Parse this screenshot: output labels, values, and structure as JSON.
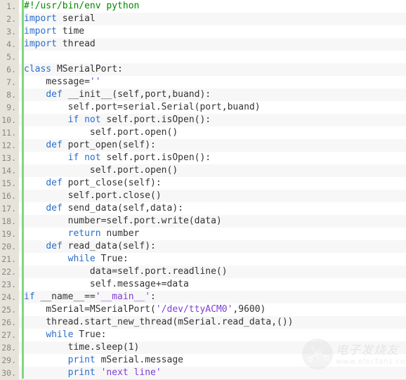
{
  "editor": {
    "language": "python",
    "gutter_suffix": ".",
    "colors": {
      "background": "#ffffff",
      "alt_row": "#f7f7f7",
      "gutter_background": "#e6e4da",
      "gutter_rule": "#7fd87f",
      "line_number": "#888680",
      "text": "#333333",
      "comment": "#008800",
      "keyword": "#2a6ecb",
      "string": "#7d3fd4"
    },
    "lines": [
      {
        "number": "1.",
        "tokens": [
          {
            "t": "#!/usr/bin/env python",
            "c": "comment"
          }
        ]
      },
      {
        "number": "2.",
        "tokens": [
          {
            "t": "import",
            "c": "keyword"
          },
          {
            "t": " serial",
            "c": "plain"
          }
        ]
      },
      {
        "number": "3.",
        "tokens": [
          {
            "t": "import",
            "c": "keyword"
          },
          {
            "t": " time",
            "c": "plain"
          }
        ]
      },
      {
        "number": "4.",
        "tokens": [
          {
            "t": "import",
            "c": "keyword"
          },
          {
            "t": " thread",
            "c": "plain"
          }
        ]
      },
      {
        "number": "5.",
        "tokens": []
      },
      {
        "number": "6.",
        "tokens": [
          {
            "t": "class",
            "c": "keyword"
          },
          {
            "t": " MSerialPort:",
            "c": "plain"
          }
        ]
      },
      {
        "number": "7.",
        "tokens": [
          {
            "t": "    message=",
            "c": "plain"
          },
          {
            "t": "''",
            "c": "string"
          }
        ]
      },
      {
        "number": "8.",
        "tokens": [
          {
            "t": "    ",
            "c": "plain"
          },
          {
            "t": "def",
            "c": "keyword"
          },
          {
            "t": " __init__(self,port,buand):",
            "c": "plain"
          }
        ]
      },
      {
        "number": "9.",
        "tokens": [
          {
            "t": "        self.port=serial.Serial(port,buand)",
            "c": "plain"
          }
        ]
      },
      {
        "number": "10.",
        "tokens": [
          {
            "t": "        ",
            "c": "plain"
          },
          {
            "t": "if not",
            "c": "keyword"
          },
          {
            "t": " self.port.isOpen():",
            "c": "plain"
          }
        ]
      },
      {
        "number": "11.",
        "tokens": [
          {
            "t": "            self.port.open()",
            "c": "plain"
          }
        ]
      },
      {
        "number": "12.",
        "tokens": [
          {
            "t": "    ",
            "c": "plain"
          },
          {
            "t": "def",
            "c": "keyword"
          },
          {
            "t": " port_open(self):",
            "c": "plain"
          }
        ]
      },
      {
        "number": "13.",
        "tokens": [
          {
            "t": "        ",
            "c": "plain"
          },
          {
            "t": "if not",
            "c": "keyword"
          },
          {
            "t": " self.port.isOpen():",
            "c": "plain"
          }
        ]
      },
      {
        "number": "14.",
        "tokens": [
          {
            "t": "            self.port.open()",
            "c": "plain"
          }
        ]
      },
      {
        "number": "15.",
        "tokens": [
          {
            "t": "    ",
            "c": "plain"
          },
          {
            "t": "def",
            "c": "keyword"
          },
          {
            "t": " port_close(self):",
            "c": "plain"
          }
        ]
      },
      {
        "number": "16.",
        "tokens": [
          {
            "t": "        self.port.close()",
            "c": "plain"
          }
        ]
      },
      {
        "number": "17.",
        "tokens": [
          {
            "t": "    ",
            "c": "plain"
          },
          {
            "t": "def",
            "c": "keyword"
          },
          {
            "t": " send_data(self,data):",
            "c": "plain"
          }
        ]
      },
      {
        "number": "18.",
        "tokens": [
          {
            "t": "        number=self.port.write(data)",
            "c": "plain"
          }
        ]
      },
      {
        "number": "19.",
        "tokens": [
          {
            "t": "        ",
            "c": "plain"
          },
          {
            "t": "return",
            "c": "keyword"
          },
          {
            "t": " number",
            "c": "plain"
          }
        ]
      },
      {
        "number": "20.",
        "tokens": [
          {
            "t": "    ",
            "c": "plain"
          },
          {
            "t": "def",
            "c": "keyword"
          },
          {
            "t": " read_data(self):",
            "c": "plain"
          }
        ]
      },
      {
        "number": "21.",
        "tokens": [
          {
            "t": "        ",
            "c": "plain"
          },
          {
            "t": "while",
            "c": "keyword"
          },
          {
            "t": " True:",
            "c": "plain"
          }
        ]
      },
      {
        "number": "22.",
        "tokens": [
          {
            "t": "            data=self.port.readline()",
            "c": "plain"
          }
        ]
      },
      {
        "number": "23.",
        "tokens": [
          {
            "t": "            self.message+=data",
            "c": "plain"
          }
        ]
      },
      {
        "number": "24.",
        "tokens": [
          {
            "t": "if",
            "c": "keyword"
          },
          {
            "t": " __name__==",
            "c": "plain"
          },
          {
            "t": "'__main__'",
            "c": "string"
          },
          {
            "t": ":",
            "c": "plain"
          }
        ]
      },
      {
        "number": "25.",
        "tokens": [
          {
            "t": "    mSerial=MSerialPort(",
            "c": "plain"
          },
          {
            "t": "'/dev/ttyACM0'",
            "c": "string"
          },
          {
            "t": ",9600)",
            "c": "plain"
          }
        ]
      },
      {
        "number": "26.",
        "tokens": [
          {
            "t": "    thread.start_new_thread(mSerial.read_data,())",
            "c": "plain"
          }
        ]
      },
      {
        "number": "27.",
        "tokens": [
          {
            "t": "    ",
            "c": "plain"
          },
          {
            "t": "while",
            "c": "keyword"
          },
          {
            "t": " True:",
            "c": "plain"
          }
        ]
      },
      {
        "number": "28.",
        "tokens": [
          {
            "t": "        time.sleep(1)",
            "c": "plain"
          }
        ]
      },
      {
        "number": "29.",
        "tokens": [
          {
            "t": "        ",
            "c": "plain"
          },
          {
            "t": "print",
            "c": "keyword"
          },
          {
            "t": " mSerial.message",
            "c": "plain"
          }
        ]
      },
      {
        "number": "30.",
        "tokens": [
          {
            "t": "        ",
            "c": "plain"
          },
          {
            "t": "print",
            "c": "keyword"
          },
          {
            "t": " ",
            "c": "plain"
          },
          {
            "t": "'next line'",
            "c": "string"
          }
        ]
      }
    ]
  },
  "watermark": {
    "brand_cn": "电子发烧友",
    "url": "www.elecfans.com"
  }
}
